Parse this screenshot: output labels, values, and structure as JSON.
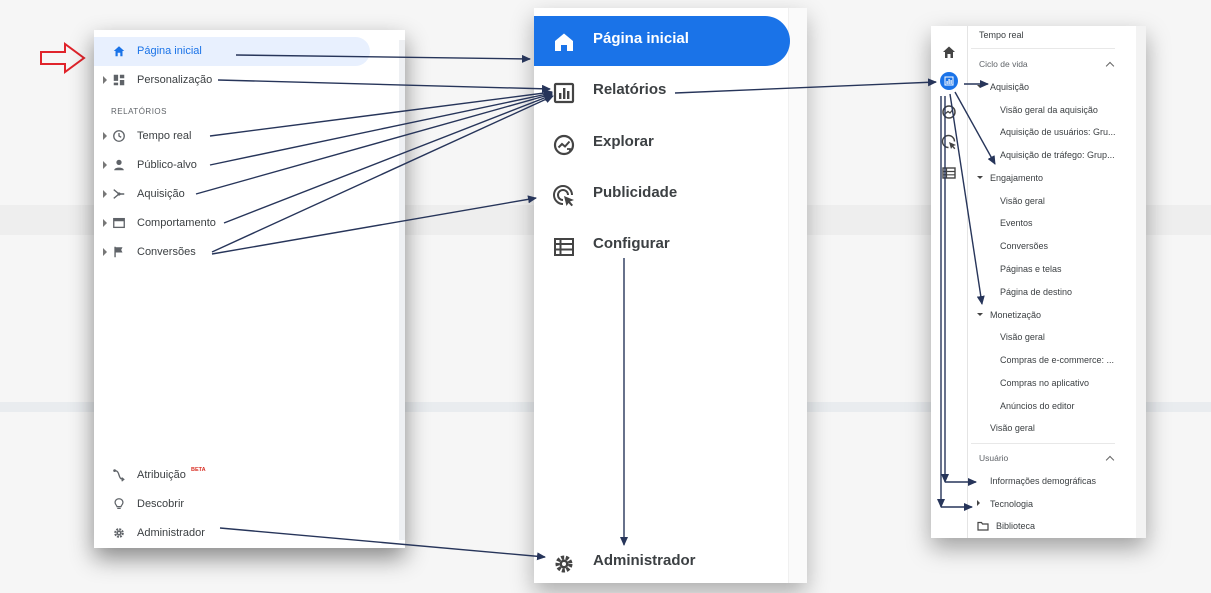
{
  "old_menu": {
    "items": [
      {
        "label": "Página inicial",
        "icon": "home-icon",
        "active": true,
        "caret": false
      },
      {
        "label": "Personalização",
        "icon": "dashboard-icon",
        "active": false,
        "caret": true
      },
      {
        "label": "Tempo real",
        "icon": "clock-icon",
        "active": false,
        "caret": true
      },
      {
        "label": "Público-alvo",
        "icon": "person-icon",
        "active": false,
        "caret": true
      },
      {
        "label": "Aquisição",
        "icon": "acquisition-icon",
        "active": false,
        "caret": true
      },
      {
        "label": "Comportamento",
        "icon": "behavior-icon",
        "active": false,
        "caret": true
      },
      {
        "label": "Conversões",
        "icon": "flag-icon",
        "active": false,
        "caret": true
      }
    ],
    "section_label": "RELATÓRIOS",
    "bottom_items": [
      {
        "label": "Atribuição",
        "icon": "attribution-icon",
        "badge": "BETA"
      },
      {
        "label": "Descobrir",
        "icon": "lightbulb-icon"
      },
      {
        "label": "Administrador",
        "icon": "gear-icon"
      }
    ]
  },
  "new_nav": {
    "items": [
      {
        "label": "Página inicial",
        "icon": "home-icon",
        "active": true
      },
      {
        "label": "Relatórios",
        "icon": "reports-icon",
        "active": false
      },
      {
        "label": "Explorar",
        "icon": "explore-icon",
        "active": false
      },
      {
        "label": "Publicidade",
        "icon": "advertising-icon",
        "active": false
      },
      {
        "label": "Configurar",
        "icon": "configure-icon",
        "active": false
      }
    ],
    "admin_label": "Administrador"
  },
  "reports_tree": {
    "top_item": "Tempo real",
    "lifecycle_header": "Ciclo de vida",
    "acquisition": {
      "label": "Aquisição",
      "children": [
        "Visão geral da aquisição",
        "Aquisição de usuários: Gru...",
        "Aquisição de tráfego: Grup..."
      ]
    },
    "engagement": {
      "label": "Engajamento",
      "children": [
        "Visão geral",
        "Eventos",
        "Conversões",
        "Páginas e telas",
        "Página de destino"
      ]
    },
    "monetization": {
      "label": "Monetização",
      "children": [
        "Visão geral",
        "Compras de e-commerce: ...",
        "Compras no aplicativo",
        "Anúncios do editor"
      ]
    },
    "lifecycle_overview": "Visão geral",
    "user_header": "Usuário",
    "demographics": "Informações demográficas",
    "technology": "Tecnologia",
    "library": "Biblioteca"
  },
  "colors": {
    "accent": "#1a73e8",
    "active_bg": "#e8f0fe",
    "arrow": "#27355a",
    "pointer_arrow": "#e0242b",
    "beta": "#d93025"
  }
}
